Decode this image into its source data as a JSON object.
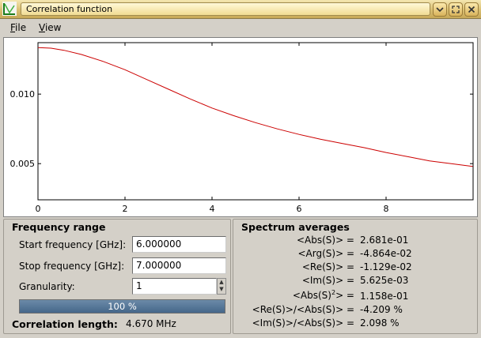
{
  "window": {
    "title": "Correlation function",
    "accent": "#d9bf72"
  },
  "menu": [
    {
      "label": "File",
      "mnemonic": "F",
      "rest": "ile"
    },
    {
      "label": "View",
      "mnemonic": "V",
      "rest": "iew"
    }
  ],
  "chart_data": {
    "type": "line",
    "title": "",
    "xlabel": "",
    "ylabel": "",
    "xlim": [
      0,
      10
    ],
    "ylim": [
      0.0024,
      0.0137
    ],
    "x_ticks": [
      "0",
      "2",
      "4",
      "6",
      "8"
    ],
    "y_ticks": [
      "0.010",
      "0.005"
    ],
    "grid": false,
    "series": [
      {
        "color": "#cc0000",
        "x": [
          0,
          0.3,
          0.6,
          1.0,
          1.5,
          2.0,
          2.5,
          3.0,
          3.5,
          4.0,
          4.5,
          5.0,
          5.5,
          6.0,
          6.5,
          7.0,
          7.5,
          8.0,
          8.5,
          9.0,
          9.5,
          9.99
        ],
        "y": [
          0.01335,
          0.0133,
          0.01315,
          0.01285,
          0.01235,
          0.01175,
          0.01105,
          0.01035,
          0.00965,
          0.009,
          0.00845,
          0.00795,
          0.0075,
          0.0071,
          0.00675,
          0.00645,
          0.00615,
          0.0058,
          0.0055,
          0.0052,
          0.005,
          0.0048
        ]
      }
    ]
  },
  "frequency_range": {
    "title": "Frequency range",
    "start_label": "Start frequency [GHz]:",
    "start_value": "6.000000",
    "stop_label": "Stop frequency [GHz]:",
    "stop_value": "7.000000",
    "granularity_label": "Granularity:",
    "granularity_value": "1",
    "progress_text": "100 %",
    "progress_fraction": 1.0,
    "corr_label": "Correlation length:",
    "corr_value": "4.670 MHz"
  },
  "spectrum": {
    "title": "Spectrum averages",
    "rows": [
      {
        "key": "<Abs(S)> =",
        "value": "2.681e-01"
      },
      {
        "key": "<Arg(S)> =",
        "value": "-4.864e-02"
      },
      {
        "key": "<Re(S)> =",
        "value": "-1.129e-02"
      },
      {
        "key": "<Im(S)> =",
        "value": "5.625e-03"
      },
      {
        "key": "<Abs(S)",
        "sup": "2",
        "key_tail": "> =",
        "value": "1.158e-01"
      },
      {
        "key": "<Re(S)>/<Abs(S)> =",
        "value": "-4.209 %"
      },
      {
        "key": "<Im(S)>/<Abs(S)> =",
        "value": "2.098 %"
      }
    ]
  }
}
